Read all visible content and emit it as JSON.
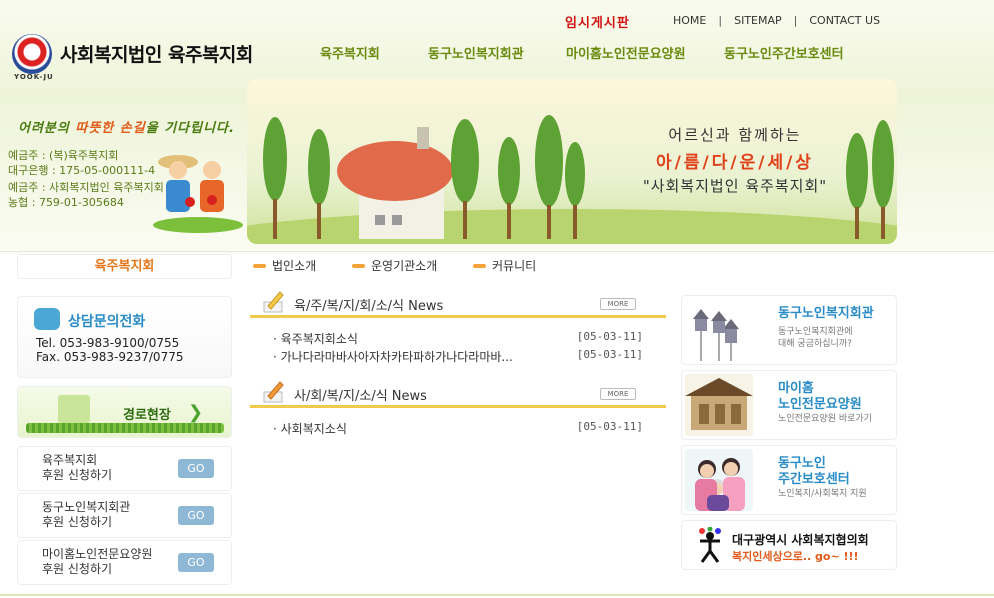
{
  "header": {
    "board_label": "임시게시판",
    "top_links": [
      "HOME",
      "SITEMAP",
      "CONTACT US"
    ],
    "separator": "|",
    "logo_sub": "YOOK-JU",
    "org_name": "사회복지법인 육주복지회",
    "gnb": [
      "육주복지회",
      "동구노인복지회관",
      "마이홈노인전문요양원",
      "동구노인주간보호센터"
    ]
  },
  "hero": {
    "slogan": [
      "어려분의 ",
      "따뜻한 손길",
      "을 기다립니다."
    ],
    "accounts": [
      "예금주 : (복)육주복지회",
      "대구은행 : 175-05-000111-4",
      "예금주 : 사회복지법인 육주복지회",
      "농협 : 759-01-305684"
    ],
    "banner_line1": "어르신과 함께하는",
    "banner_line2": "아/름/다/운/세/상",
    "banner_line3": "\"사회복지법인 육주복지회\""
  },
  "subnav": {
    "section_title": "육주복지회",
    "items": [
      "법인소개",
      "운영기관소개",
      "커뮤니티"
    ]
  },
  "left": {
    "tel_title": "상담문의전화",
    "tel": "Tel.  053-983-9100/0755",
    "fax": "Fax.  053-983-9237/0775",
    "field_label": "경로현장",
    "support": [
      {
        "line1": "육주복지회",
        "line2": "후원 신청하기",
        "button": "GO"
      },
      {
        "line1": "동구노인복지회관",
        "line2": "후원 신청하기",
        "button": "GO"
      },
      {
        "line1": "마이홈노인전문요양원",
        "line2": "후원 신청하기",
        "button": "GO"
      }
    ]
  },
  "news": [
    {
      "title": "육/주/복/지/회/소/식 News",
      "more": "MORE",
      "items": [
        {
          "subject": "· 육주복지회소식",
          "date": "[05-03-11]"
        },
        {
          "subject": "· 가나다라마바사아자차카타파하가나다라마바...",
          "date": "[05-03-11]"
        }
      ]
    },
    {
      "title": "사/회/복/지/소/식 News",
      "more": "MORE",
      "items": [
        {
          "subject": "· 사회복지소식",
          "date": "[05-03-11]"
        }
      ]
    }
  ],
  "right": {
    "boxes": [
      {
        "title": "동구노인복지회관",
        "sub": [
          "동구노인복지회관에",
          "대해 궁금하십니까?"
        ]
      },
      {
        "title": "마이홈\n노인전문요양원",
        "title1": "마이홈",
        "title2": "노인전문요양원",
        "sub": [
          "노인전문요양원 바로가기"
        ]
      },
      {
        "title1": "동구노인",
        "title2": "주간보호센터",
        "sub": [
          "노인복지/사회복지 지원"
        ]
      }
    ],
    "council_title": "대구광역시 사회복지협의회",
    "council_sub": "복지인세상으로.. go~ !!!"
  }
}
